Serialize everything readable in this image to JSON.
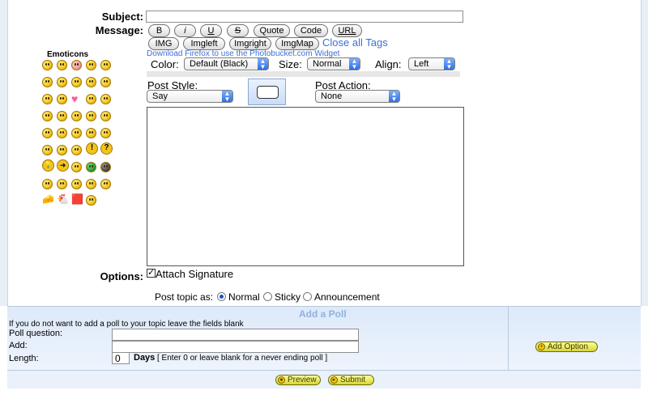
{
  "form": {
    "subject_label": "Subject:",
    "message_label": "Message:",
    "options_label": "Options:"
  },
  "tags": {
    "row1": [
      "B",
      "i",
      "U",
      "S",
      "Quote",
      "Code",
      "URL"
    ],
    "row2": [
      "IMG",
      "Imgleft",
      "Imgright",
      "ImgMap"
    ],
    "close_all": "Close all Tags",
    "download_link": "Download Firefox to use the Photobucket.com Widget"
  },
  "formatting": {
    "color_label": "Color:",
    "color_value": "Default (Black)",
    "size_label": "Size:",
    "size_value": "Normal",
    "align_label": "Align:",
    "align_value": "Left"
  },
  "post": {
    "style_label": "Post Style:",
    "style_value": "Say",
    "action_label": "Post Action:",
    "action_value": "None"
  },
  "emoticons": {
    "title": "Emoticons"
  },
  "options": {
    "attach_signature": "Attach Signature",
    "post_topic_as": "Post topic as:",
    "normal": "Normal",
    "sticky": "Sticky",
    "announcement": "Announcement"
  },
  "poll": {
    "title": "Add a Poll",
    "hint": "If you do not want to add a poll to your topic leave the fields blank",
    "question_label": "Poll question:",
    "add_label": "Add:",
    "length_label": "Length:",
    "length_value": "0",
    "days_label": "Days",
    "days_hint": "[ Enter 0 or leave blank for a never ending poll ]",
    "add_option": "Add Option"
  },
  "actions": {
    "preview": "Preview",
    "submit": "Submit"
  },
  "colors": {
    "link": "#3c6fd8",
    "poll_title": "#8fb2de",
    "select_arrow": "#2f6fe0"
  }
}
